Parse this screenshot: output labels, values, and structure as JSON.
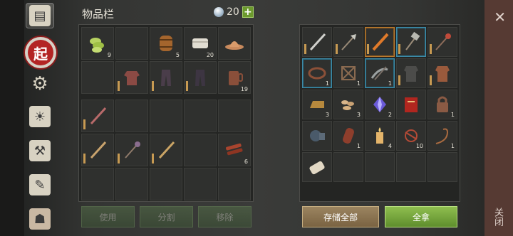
{
  "header": {
    "title": "物品栏",
    "currency_value": "20"
  },
  "side_tabs": [
    {
      "name": "side-tab-backpack"
    },
    {
      "name": "side-tab-crafting-main",
      "glyph": "起"
    },
    {
      "name": "side-tab-buildings"
    },
    {
      "name": "side-tab-journal"
    },
    {
      "name": "side-tab-tools"
    },
    {
      "name": "side-tab-map"
    },
    {
      "name": "side-tab-character"
    }
  ],
  "inventory_counts": {
    "r0c0": "9",
    "r0c2": "5",
    "r0c3": "20",
    "r1c4": "19",
    "r4c4": "6"
  },
  "container_counts": {
    "r1c0": "1",
    "r1c1": "1",
    "r1c2": "1",
    "r2c0": "3",
    "r2c1": "3",
    "r2c2": "2",
    "r2c4": "1",
    "r3c1": "1",
    "r3c2": "4",
    "r3c3": "10",
    "r3c4": "1"
  },
  "buttons": {
    "use": "使用",
    "split": "分割",
    "remove": "移除",
    "store_all": "存储全部",
    "take_all": "全拿"
  },
  "close": {
    "label": "关闭",
    "x": "✕"
  }
}
